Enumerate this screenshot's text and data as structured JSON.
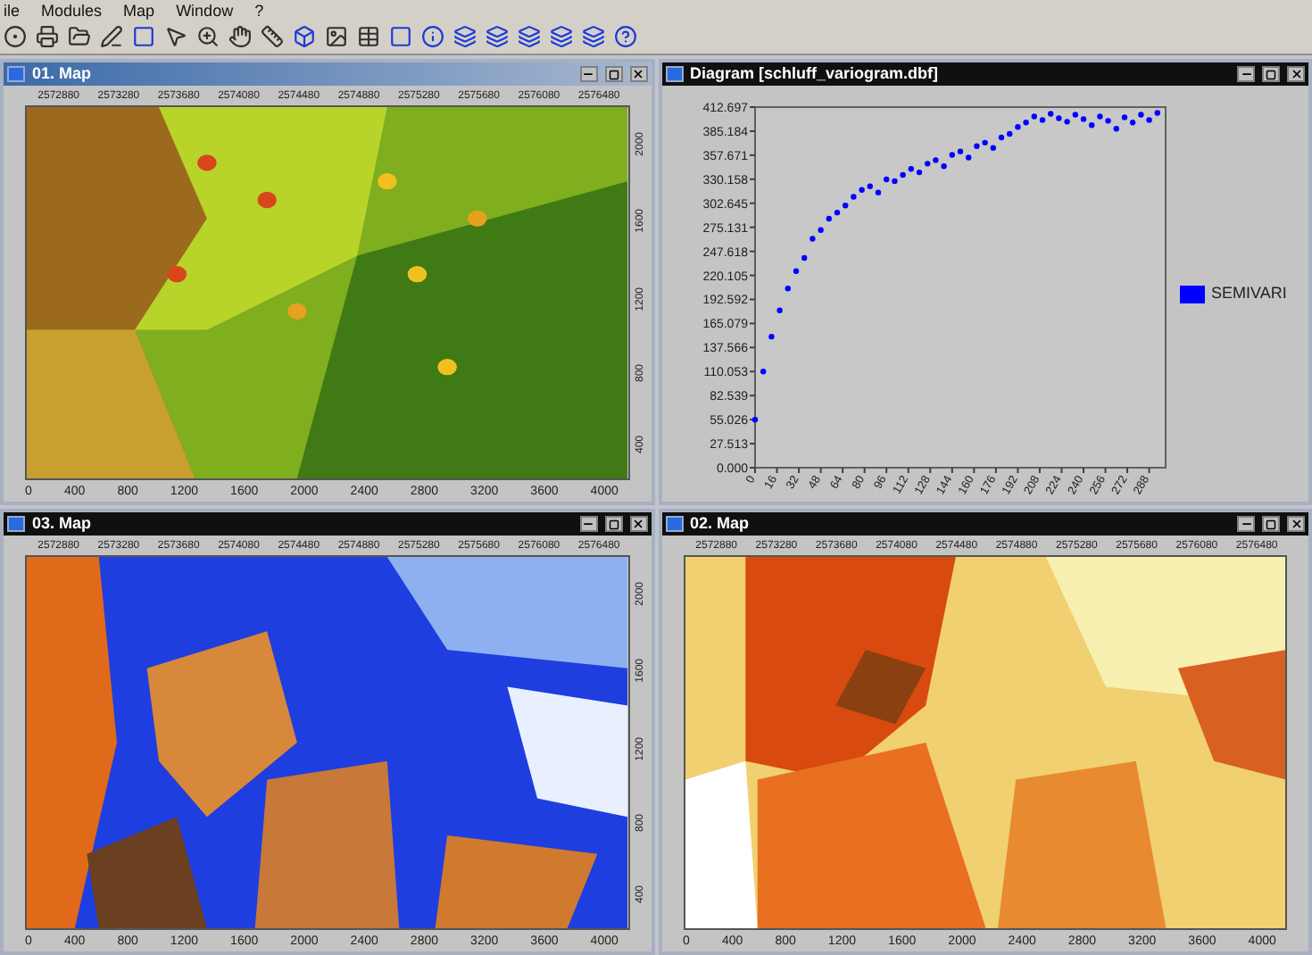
{
  "menu": [
    "ile",
    "Modules",
    "Map",
    "Window",
    "?"
  ],
  "windows": [
    {
      "kind": "map",
      "title": "01. Map",
      "active": true,
      "top_axis": [
        "2572880",
        "2573280",
        "2573680",
        "2574080",
        "2574480",
        "2574880",
        "2575280",
        "2575680",
        "2576080",
        "2576480"
      ],
      "bottom_axis": [
        "0",
        "400",
        "800",
        "1200",
        "1600",
        "2000",
        "2400",
        "2800",
        "3200",
        "3600",
        "4000"
      ],
      "right_axis": [
        "2000",
        "1600",
        "1200",
        "800",
        "400"
      ],
      "picture": {
        "kind": "picture"
      }
    },
    {
      "kind": "diagram",
      "title": "Diagram [schluff_variogram.dbf]",
      "active": false,
      "chart_data": {
        "type": "scatter",
        "xlim": [
          0,
          300
        ],
        "ylim": [
          0,
          412.697
        ],
        "yticks": [
          {
            "value": 0,
            "label": "0.000"
          },
          {
            "value": 27.513,
            "label": "27.513"
          },
          {
            "value": 55.026,
            "label": "55.026"
          },
          {
            "value": 82.539,
            "label": "82.539"
          },
          {
            "value": 110.053,
            "label": "110.053"
          },
          {
            "value": 137.566,
            "label": "137.566"
          },
          {
            "value": 165.079,
            "label": "165.079"
          },
          {
            "value": 192.592,
            "label": "192.592"
          },
          {
            "value": 220.105,
            "label": "220.105"
          },
          {
            "value": 247.618,
            "label": "247.618"
          },
          {
            "value": 275.131,
            "label": "275.131"
          },
          {
            "value": 302.645,
            "label": "302.645"
          },
          {
            "value": 330.158,
            "label": "330.158"
          },
          {
            "value": 357.671,
            "label": "357.671"
          },
          {
            "value": 385.184,
            "label": "385.184"
          },
          {
            "value": 412.697,
            "label": "412.697"
          }
        ],
        "xticks": [
          0,
          16,
          32,
          48,
          64,
          80,
          96,
          112,
          128,
          144,
          160,
          176,
          192,
          208,
          224,
          240,
          256,
          272,
          288
        ],
        "x": [
          0,
          6,
          12,
          18,
          24,
          30,
          36,
          42,
          48,
          54,
          60,
          66,
          72,
          78,
          84,
          90,
          96,
          102,
          108,
          114,
          120,
          126,
          132,
          138,
          144,
          150,
          156,
          162,
          168,
          174,
          180,
          186,
          192,
          198,
          204,
          210,
          216,
          222,
          228,
          234,
          240,
          246,
          252,
          258,
          264,
          270,
          276,
          282,
          288,
          294
        ],
        "series": [
          {
            "name": "SEMIVARI",
            "color": "#0000ff",
            "values": [
              55,
              110,
              150,
              180,
              205,
              225,
              240,
              262,
              272,
              285,
              292,
              300,
              310,
              318,
              322,
              315,
              330,
              328,
              335,
              342,
              338,
              348,
              352,
              345,
              358,
              362,
              355,
              368,
              372,
              366,
              378,
              382,
              390,
              395,
              402,
              398,
              405,
              400,
              396,
              404,
              399,
              392,
              402,
              397,
              388,
              401,
              395,
              404,
              398,
              406
            ]
          }
        ]
      }
    },
    {
      "kind": "map",
      "title": "03. Map",
      "active": false,
      "top_axis": [
        "2572880",
        "2573280",
        "2573680",
        "2574080",
        "2574480",
        "2574880",
        "2575280",
        "2575680",
        "2576080",
        "2576480"
      ],
      "bottom_axis": [
        "0",
        "400",
        "800",
        "1200",
        "1600",
        "2000",
        "2400",
        "2800",
        "3200",
        "3600",
        "4000"
      ],
      "right_axis": [
        "2000",
        "1600",
        "1200",
        "800",
        "400"
      ],
      "picture": {
        "kind": "picture"
      }
    },
    {
      "kind": "map",
      "title": "02. Map",
      "active": false,
      "top_axis": [
        "2572880",
        "2573280",
        "2573680",
        "2574080",
        "2574480",
        "2574880",
        "2575280",
        "2575680",
        "2576080",
        "2576480"
      ],
      "bottom_axis": [
        "0",
        "400",
        "800",
        "1200",
        "1600",
        "2000",
        "2400",
        "2800",
        "3200",
        "3600",
        "4000"
      ],
      "picture": {
        "kind": "picture"
      }
    }
  ]
}
